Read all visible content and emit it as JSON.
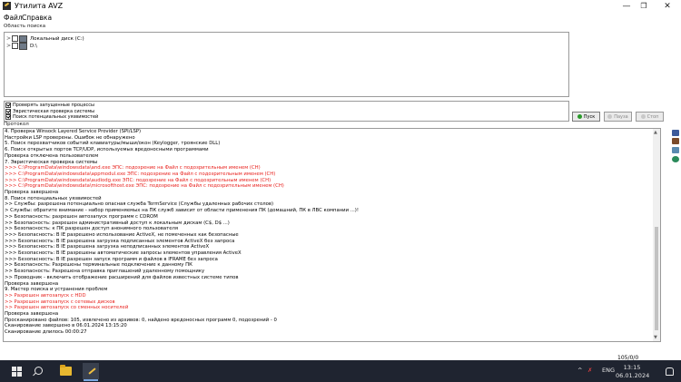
{
  "window": {
    "title": "Утилита AVZ",
    "minimize": "—",
    "restore": "❐",
    "close": "✕"
  },
  "menu": [
    "Файл",
    "Справка"
  ],
  "search_area": {
    "label": "Область поиска",
    "tree": [
      {
        "label": "Локальный диск (C:)"
      },
      {
        "label": "D:\\"
      }
    ]
  },
  "options": [
    "Проверять запущенные процессы",
    "Эвристическая проверка системы",
    "Поиск потенциальных уязвимостей"
  ],
  "buttons": {
    "start": "Пуск",
    "pause": "Пауза",
    "stop": "Стоп"
  },
  "protocol": {
    "label": "Протокол",
    "lines": [
      {
        "text": "4. Проверка Winsock Layered Service Provider (SPI/LSP)",
        "color": "black"
      },
      {
        "text": " Настройки LSP проверены. Ошибок не обнаружено",
        "color": "black"
      },
      {
        "text": "5. Поиск перехватчиков событий клавиатуры/мыши/окон (Keylogger, троянские DLL)",
        "color": "black"
      },
      {
        "text": "6. Поиск открытых портов TCP/UDP, используемых вредоносными программами",
        "color": "black"
      },
      {
        "text": " Проверка отключена пользователем",
        "color": "black"
      },
      {
        "text": "7. Эвристическая проверка системы",
        "color": "black"
      },
      {
        "text": ">>> C:\\ProgramData\\windowsdata\\and.exe ЭПС: подозрение на Файл с подозрительным именем (CH)",
        "color": "red"
      },
      {
        "text": ">>> C:\\ProgramData\\windowsdata\\appmodul.exe ЭПС: подозрение на Файл с подозрительным именем (CH)",
        "color": "red"
      },
      {
        "text": ">>> C:\\ProgramData\\windowsdata\\audiodg.exe ЭПС: подозрение на Файл с подозрительным именем (CH)",
        "color": "red"
      },
      {
        "text": ">>> C:\\ProgramData\\windowsdata\\microsofthost.exe ЭПС: подозрение на Файл с подозрительным именем (CH)",
        "color": "red"
      },
      {
        "text": "Проверка завершена",
        "color": "black"
      },
      {
        "text": "8. Поиск потенциальных уязвимостей",
        "color": "black"
      },
      {
        "text": ">> Службы: разрешена потенциально опасная служба TermService (Службы удаленных рабочих столов)",
        "color": "black"
      },
      {
        "text": "> Службы: обратите внимание - набор применяемых на ПК служб зависит от области применения ПК (домашний, ПК в ЛВС компании ...)!",
        "color": "black"
      },
      {
        "text": ">> Безопасность: разрешен автозапуск программ с CDROM",
        "color": "black"
      },
      {
        "text": ">> Безопасность: разрешен административный доступ к локальным дискам (C$, D$ ...)",
        "color": "black"
      },
      {
        "text": ">> Безопасность: к ПК разрешен доступ анонимного пользователя",
        "color": "black"
      },
      {
        "text": ">>> Безопасность: В IE разрешено использование ActiveX, не помеченных как безопасные",
        "color": "black"
      },
      {
        "text": ">>> Безопасность: В IE разрешена загрузка подписанных элементов ActiveX без запроса",
        "color": "black"
      },
      {
        "text": ">>> Безопасность: В IE разрешена загрузка неподписанных элементов ActiveX",
        "color": "black"
      },
      {
        "text": ">>> Безопасность: В IE разрешены автоматические запросы элементов управления ActiveX",
        "color": "black"
      },
      {
        "text": ">>> Безопасность: В IE разрешен запуск программ и файлов в IFRAME без запроса",
        "color": "black"
      },
      {
        "text": ">> Безопасность: Разрешены терминальные подключение к данному ПК",
        "color": "black"
      },
      {
        "text": ">> Безопасность: Разрешена отправка приглашений удаленному помощнику",
        "color": "black"
      },
      {
        "text": ">> Проводник - включить отображение расширений для файлов известных системе типов",
        "color": "black"
      },
      {
        "text": "Проверка завершена",
        "color": "black"
      },
      {
        "text": "9. Мастер поиска и устранения проблем",
        "color": "black"
      },
      {
        "text": " >> Разрешен автозапуск с HDD",
        "color": "red"
      },
      {
        "text": " >> Разрешен автозапуск с сетевых дисков",
        "color": "red"
      },
      {
        "text": " >> Разрешен автозапуск со сменных носителей",
        "color": "red"
      },
      {
        "text": "Проверка завершена",
        "color": "black"
      },
      {
        "text": "Просканировано файлов: 105, извлечено из архивов: 0, найдено вредоносных программ 0, подозрений - 0",
        "color": "black"
      },
      {
        "text": "Сканирование завершено в 06.01.2024 13:15:20",
        "color": "black"
      },
      {
        "text": "Сканирование длилось 00:00:27",
        "color": "black"
      }
    ]
  },
  "status": {
    "counter": "105/0/0"
  },
  "taskbar": {
    "language": "ENG",
    "time": "13:15",
    "date": "06.01.2024"
  },
  "colors": {
    "red_text": "#e8201c",
    "taskbar": "#1f2430",
    "start_icon": "#2a9a2a"
  }
}
